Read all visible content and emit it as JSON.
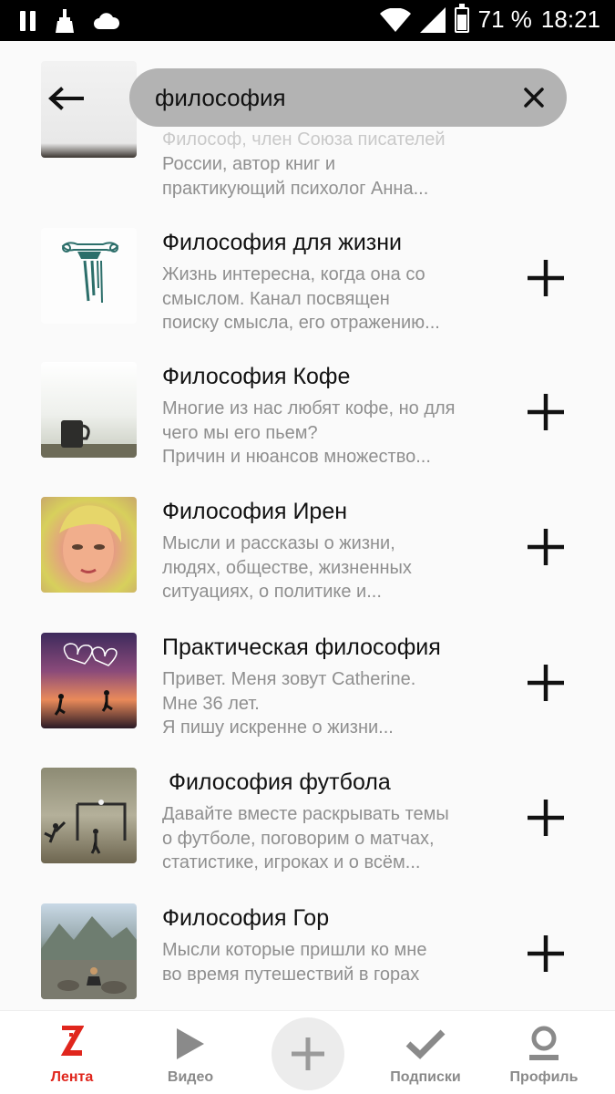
{
  "status_bar": {
    "battery_percent": "71 %",
    "time": "18:21",
    "icons": [
      "pause-icon",
      "broom-icon",
      "cloud-icon",
      "wifi-icon",
      "signal-icon",
      "battery-icon"
    ]
  },
  "search": {
    "query": "философия",
    "back_icon": "arrow-left-icon",
    "clear_icon": "close-icon"
  },
  "partial_item": {
    "desc_line1": "Философ, член Союза писателей",
    "desc_line2": "России, автор книг и",
    "desc_line3": "практикующий психолог Анна..."
  },
  "channels": [
    {
      "title": "Философия для жизни",
      "desc": [
        "Жизнь интересна, когда она со",
        "смыслом. Канал посвящен",
        "поиску смысла, его отражению..."
      ],
      "thumb": "column-capital-image"
    },
    {
      "title": "Философия Кофе",
      "desc": [
        "Многие из нас любят кофе, но для",
        "чего мы его пьем?",
        "Причин и нюансов множество..."
      ],
      "thumb": "coffee-mug-image"
    },
    {
      "title": "Философия Ирен",
      "desc": [
        "Мысли и рассказы  о жизни,",
        "людях, обществе, жизненных",
        "ситуациях, о политике и..."
      ],
      "thumb": "woman-portrait-image"
    },
    {
      "title": "Практическая философия",
      "desc": [
        "Привет. Меня зовут Catherine.",
        "Мне 36 лет.",
        "Я пишу искренне о жизни..."
      ],
      "thumb": "sunset-hearts-image"
    },
    {
      "title": " Философия футбола",
      "desc": [
        "Давайте вместе раскрывать темы",
        "о футболе, поговорим о матчах,",
        "статистике, игроках и о всём..."
      ],
      "thumb": "football-goal-image"
    },
    {
      "title": "Философия Гор",
      "desc": [
        "Мысли которые пришли ко мне",
        "во время путешествий в горах"
      ],
      "thumb": "mountain-lake-image"
    }
  ],
  "bottom_nav": {
    "items": [
      {
        "label": "Лента",
        "icon": "zen-logo-icon",
        "active": true
      },
      {
        "label": "Видео",
        "icon": "play-icon",
        "active": false
      },
      {
        "label": "Подписки",
        "icon": "checkmark-icon",
        "active": false
      },
      {
        "label": "Профиль",
        "icon": "profile-icon",
        "active": false
      }
    ],
    "create_icon": "plus-icon"
  },
  "colors": {
    "accent_red": "#e0261d",
    "search_bg": "#b3b3b3",
    "desc_gray": "#8f8f8f"
  }
}
